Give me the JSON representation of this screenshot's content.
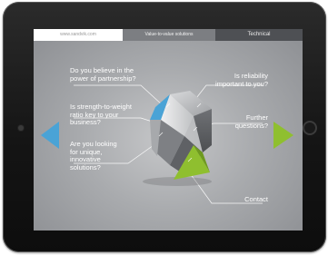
{
  "nav": {
    "url_tab": "www.sandvik.com",
    "active_tab": "Value-to-value solutions",
    "right_tab": "Technical"
  },
  "questions": {
    "partnership": "Do you believe in the power of partnership?",
    "reliability": "Is reliability important to you?",
    "strength": "Is strength-to-weight ratio key to your business?",
    "further": "Further questions?",
    "unique": "Are you looking for unique, innovative solutions?",
    "contact": "Contact"
  },
  "colors": {
    "accent_green": "#8fbf2f",
    "accent_blue": "#4aa3d6",
    "screen_gray": "#a9abae"
  },
  "icons": {
    "left": "arrow-left-triangle",
    "right": "arrow-right-triangle"
  }
}
